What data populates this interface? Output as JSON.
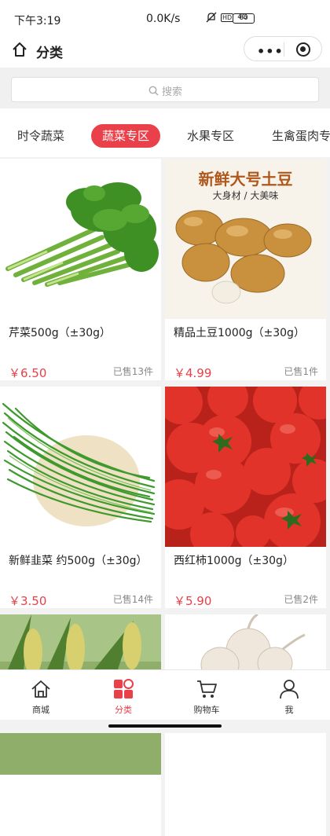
{
  "status_bar": {
    "time": "下午3:19",
    "network_speed": "0.0K/s",
    "signal": "4G",
    "battery": "60"
  },
  "header": {
    "title": "分类",
    "home_icon": "home-icon",
    "more_icon": "more-dots-icon",
    "record_icon": "record-icon"
  },
  "search": {
    "placeholder": "搜索",
    "icon": "search-icon"
  },
  "category_tabs": [
    {
      "label": "时令蔬菜",
      "active": false
    },
    {
      "label": "蔬菜专区",
      "active": true
    },
    {
      "label": "水果专区",
      "active": false
    },
    {
      "label": "生禽蛋肉专区",
      "active": false
    }
  ],
  "products": [
    {
      "name": "芹菜500g（±30g）",
      "price": "￥6.50",
      "sold": "已售13件"
    },
    {
      "name": "精品土豆1000g（±30g）",
      "price": "￥4.99",
      "sold": "已售1件",
      "banner_title": "新鲜大号土豆",
      "banner_sub": "大身材 / 大美味"
    },
    {
      "name": "新鲜韭菜 约500g（±30g）",
      "price": "￥3.50",
      "sold": "已售14件"
    },
    {
      "name": "西红柿1000g（±30g）",
      "price": "￥5.90",
      "sold": "已售2件"
    },
    {
      "name": "",
      "price": "",
      "sold": ""
    },
    {
      "name": "",
      "price": "",
      "sold": ""
    }
  ],
  "tab_bar": [
    {
      "label": "商城",
      "icon": "home-icon",
      "active": false
    },
    {
      "label": "分类",
      "icon": "category-icon",
      "active": true
    },
    {
      "label": "购物车",
      "icon": "cart-icon",
      "active": false
    },
    {
      "label": "我",
      "icon": "user-icon",
      "active": false
    }
  ],
  "colors": {
    "accent": "#e9404a",
    "background": "#f2f2f2"
  }
}
